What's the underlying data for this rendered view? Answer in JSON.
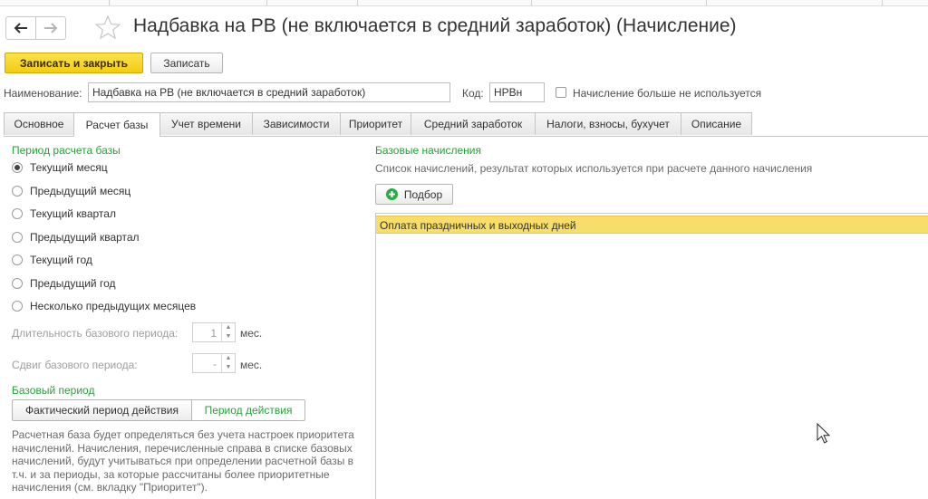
{
  "window": {
    "title": "Надбавка на РВ (не включается в средний заработок) (Начисление)"
  },
  "toolbar": {
    "save_close_label": "Записать и закрыть",
    "save_label": "Записать"
  },
  "header": {
    "name_label": "Наименование:",
    "name_value": "Надбавка на РВ (не включается в средний заработок)",
    "code_label": "Код:",
    "code_value": "НРВн",
    "unused_label": "Начисление больше не используется",
    "unused_checked": false
  },
  "tabs": [
    {
      "label": "Основное",
      "active": false
    },
    {
      "label": "Расчет базы",
      "active": true
    },
    {
      "label": "Учет времени",
      "active": false
    },
    {
      "label": "Зависимости",
      "active": false
    },
    {
      "label": "Приоритет",
      "active": false
    },
    {
      "label": "Средний заработок",
      "active": false
    },
    {
      "label": "Налоги, взносы, бухучет",
      "active": false
    },
    {
      "label": "Описание",
      "active": false
    }
  ],
  "base_period": {
    "title": "Период расчета базы",
    "options": [
      {
        "label": "Текущий месяц",
        "selected": true
      },
      {
        "label": "Предыдущий месяц",
        "selected": false
      },
      {
        "label": "Текущий квартал",
        "selected": false
      },
      {
        "label": "Предыдущий квартал",
        "selected": false
      },
      {
        "label": "Текущий год",
        "selected": false
      },
      {
        "label": "Предыдущий год",
        "selected": false
      },
      {
        "label": "Несколько предыдущих месяцев",
        "selected": false
      }
    ],
    "duration_label": "Длительность базового периода:",
    "duration_value": "1",
    "duration_unit": "мес.",
    "shift_label": "Сдвиг базового периода:",
    "shift_value": "-",
    "shift_unit": "мес."
  },
  "base_period_mode": {
    "title": "Базовый период",
    "option_actual": "Фактический период действия",
    "option_action": "Период действия",
    "selected": "option_action",
    "note": "Расчетная база будет определяться без учета настроек приоритета начислений. Начисления, перечисленные справа в списке базовых начислений, будут учитываться при определении расчетной базы в т.ч. и за периоды, за которые рассчитаны более приоритетные начисления (см. вкладку \"Приоритет\")."
  },
  "base_accruals": {
    "title": "Базовые начисления",
    "description": "Список начислений, результат которых используется при расчете данного начисления",
    "pick_label": "Подбор",
    "items": [
      "Оплата праздничных и выходных дней"
    ]
  },
  "colors": {
    "accent_green": "#29a03c",
    "save_button_yellow": "#f3cb12",
    "selected_row": "#f7dd6a"
  }
}
